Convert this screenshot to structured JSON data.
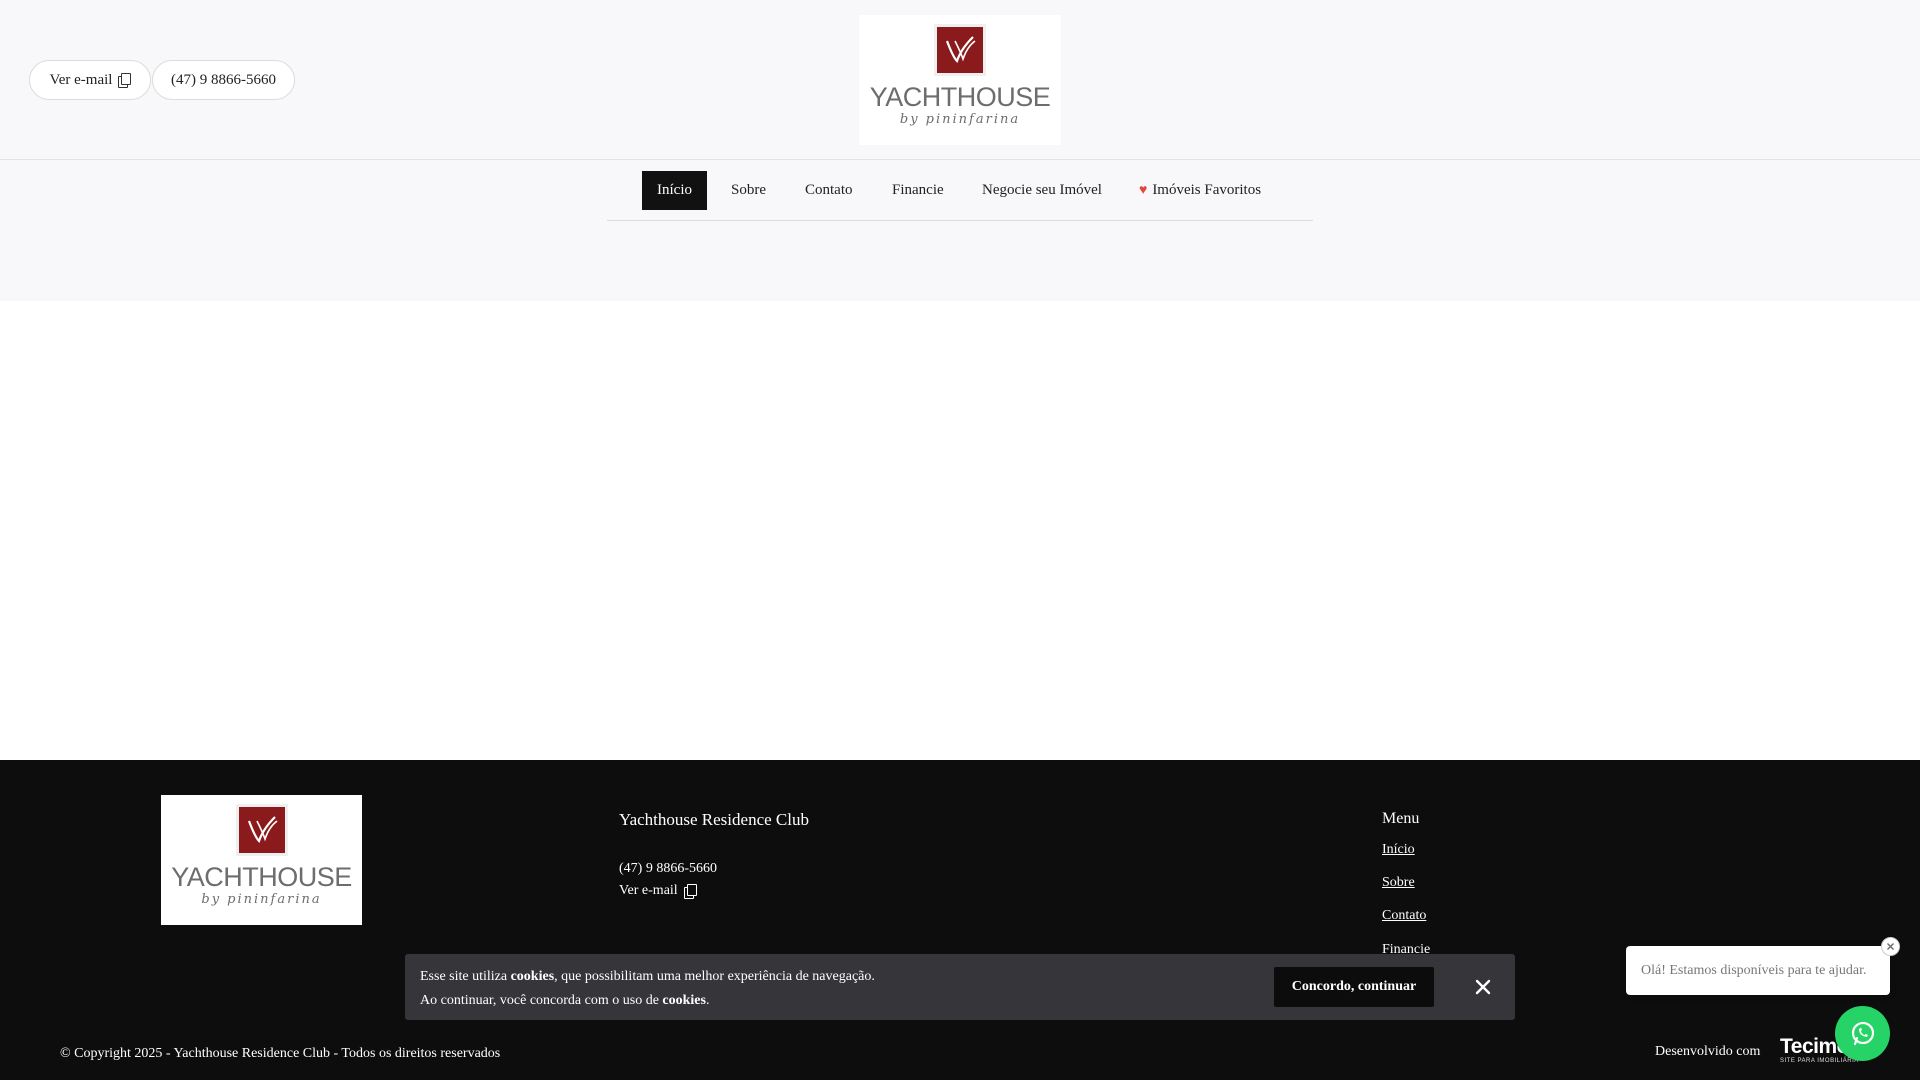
{
  "header": {
    "email_label": "Ver e-mail",
    "phone": "(47) 9 8866-5660",
    "logo": {
      "word": "YACHTHOUSE",
      "sub": "by pininfarina"
    }
  },
  "nav": {
    "items": [
      {
        "label": "Início",
        "active": true
      },
      {
        "label": "Sobre"
      },
      {
        "label": "Contato"
      },
      {
        "label": "Financie"
      },
      {
        "label": "Negocie seu Imóvel"
      },
      {
        "label": "Imóveis Favoritos",
        "icon": "heart-icon"
      }
    ]
  },
  "footer": {
    "logo": {
      "word": "YACHTHOUSE",
      "sub": "by pininfarina"
    },
    "company_name": "Yachthouse Residence Club",
    "phone": "(47) 9 8866-5660",
    "email_label": "Ver e-mail",
    "menu_title": "Menu",
    "menu_items": [
      "Início",
      "Sobre",
      "Contato",
      "Financie"
    ],
    "copyright": "© Copyright 2025 - Yachthouse Residence Club - Todos os direitos reservados",
    "developed_by": "Desenvolvido com",
    "dev_logo": {
      "word": "Tecimob",
      "sub": "SITE PARA IMOBILIÁRIA"
    }
  },
  "cookie_bar": {
    "line1_a": "Esse site utiliza ",
    "line1_b": "cookies",
    "line1_c": ", que possibilitam uma melhor experiência de navegação.",
    "line2_a": "Ao continuar, você concorda com o uso de ",
    "line2_b": "cookies",
    "line2_c": ".",
    "accept_label": "Concordo, continuar"
  },
  "chat": {
    "message": "Olá! Estamos disponíveis para te ajudar."
  },
  "colors": {
    "header_bg": "#f8f8fa",
    "footer_bg": "#0d0d0d",
    "brand_red": "#8b1a1c",
    "whatsapp_green": "#25d366",
    "heart_red": "#e0483c"
  }
}
